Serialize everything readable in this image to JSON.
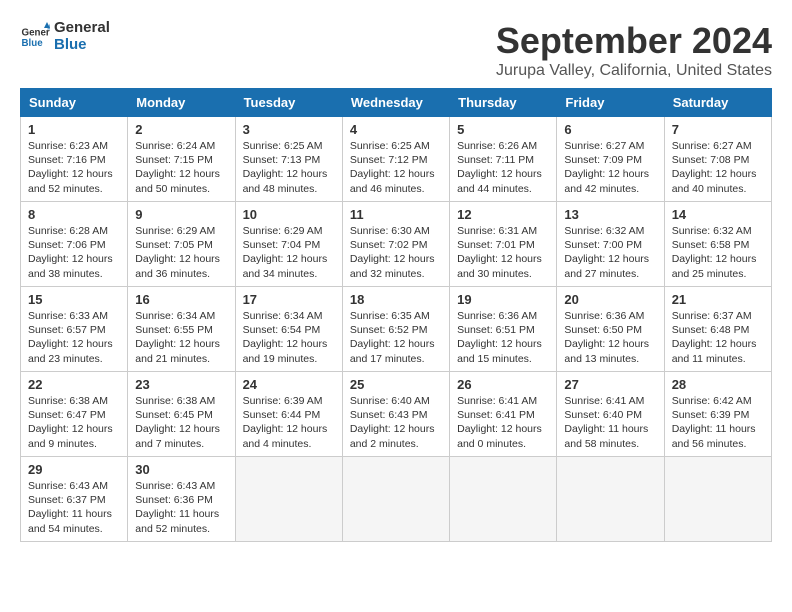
{
  "header": {
    "logo_line1": "General",
    "logo_line2": "Blue",
    "title": "September 2024",
    "subtitle": "Jurupa Valley, California, United States"
  },
  "columns": [
    "Sunday",
    "Monday",
    "Tuesday",
    "Wednesday",
    "Thursday",
    "Friday",
    "Saturday"
  ],
  "weeks": [
    [
      {
        "day": "1",
        "info": "Sunrise: 6:23 AM\nSunset: 7:16 PM\nDaylight: 12 hours\nand 52 minutes."
      },
      {
        "day": "2",
        "info": "Sunrise: 6:24 AM\nSunset: 7:15 PM\nDaylight: 12 hours\nand 50 minutes."
      },
      {
        "day": "3",
        "info": "Sunrise: 6:25 AM\nSunset: 7:13 PM\nDaylight: 12 hours\nand 48 minutes."
      },
      {
        "day": "4",
        "info": "Sunrise: 6:25 AM\nSunset: 7:12 PM\nDaylight: 12 hours\nand 46 minutes."
      },
      {
        "day": "5",
        "info": "Sunrise: 6:26 AM\nSunset: 7:11 PM\nDaylight: 12 hours\nand 44 minutes."
      },
      {
        "day": "6",
        "info": "Sunrise: 6:27 AM\nSunset: 7:09 PM\nDaylight: 12 hours\nand 42 minutes."
      },
      {
        "day": "7",
        "info": "Sunrise: 6:27 AM\nSunset: 7:08 PM\nDaylight: 12 hours\nand 40 minutes."
      }
    ],
    [
      {
        "day": "8",
        "info": "Sunrise: 6:28 AM\nSunset: 7:06 PM\nDaylight: 12 hours\nand 38 minutes."
      },
      {
        "day": "9",
        "info": "Sunrise: 6:29 AM\nSunset: 7:05 PM\nDaylight: 12 hours\nand 36 minutes."
      },
      {
        "day": "10",
        "info": "Sunrise: 6:29 AM\nSunset: 7:04 PM\nDaylight: 12 hours\nand 34 minutes."
      },
      {
        "day": "11",
        "info": "Sunrise: 6:30 AM\nSunset: 7:02 PM\nDaylight: 12 hours\nand 32 minutes."
      },
      {
        "day": "12",
        "info": "Sunrise: 6:31 AM\nSunset: 7:01 PM\nDaylight: 12 hours\nand 30 minutes."
      },
      {
        "day": "13",
        "info": "Sunrise: 6:32 AM\nSunset: 7:00 PM\nDaylight: 12 hours\nand 27 minutes."
      },
      {
        "day": "14",
        "info": "Sunrise: 6:32 AM\nSunset: 6:58 PM\nDaylight: 12 hours\nand 25 minutes."
      }
    ],
    [
      {
        "day": "15",
        "info": "Sunrise: 6:33 AM\nSunset: 6:57 PM\nDaylight: 12 hours\nand 23 minutes."
      },
      {
        "day": "16",
        "info": "Sunrise: 6:34 AM\nSunset: 6:55 PM\nDaylight: 12 hours\nand 21 minutes."
      },
      {
        "day": "17",
        "info": "Sunrise: 6:34 AM\nSunset: 6:54 PM\nDaylight: 12 hours\nand 19 minutes."
      },
      {
        "day": "18",
        "info": "Sunrise: 6:35 AM\nSunset: 6:52 PM\nDaylight: 12 hours\nand 17 minutes."
      },
      {
        "day": "19",
        "info": "Sunrise: 6:36 AM\nSunset: 6:51 PM\nDaylight: 12 hours\nand 15 minutes."
      },
      {
        "day": "20",
        "info": "Sunrise: 6:36 AM\nSunset: 6:50 PM\nDaylight: 12 hours\nand 13 minutes."
      },
      {
        "day": "21",
        "info": "Sunrise: 6:37 AM\nSunset: 6:48 PM\nDaylight: 12 hours\nand 11 minutes."
      }
    ],
    [
      {
        "day": "22",
        "info": "Sunrise: 6:38 AM\nSunset: 6:47 PM\nDaylight: 12 hours\nand 9 minutes."
      },
      {
        "day": "23",
        "info": "Sunrise: 6:38 AM\nSunset: 6:45 PM\nDaylight: 12 hours\nand 7 minutes."
      },
      {
        "day": "24",
        "info": "Sunrise: 6:39 AM\nSunset: 6:44 PM\nDaylight: 12 hours\nand 4 minutes."
      },
      {
        "day": "25",
        "info": "Sunrise: 6:40 AM\nSunset: 6:43 PM\nDaylight: 12 hours\nand 2 minutes."
      },
      {
        "day": "26",
        "info": "Sunrise: 6:41 AM\nSunset: 6:41 PM\nDaylight: 12 hours\nand 0 minutes."
      },
      {
        "day": "27",
        "info": "Sunrise: 6:41 AM\nSunset: 6:40 PM\nDaylight: 11 hours\nand 58 minutes."
      },
      {
        "day": "28",
        "info": "Sunrise: 6:42 AM\nSunset: 6:39 PM\nDaylight: 11 hours\nand 56 minutes."
      }
    ],
    [
      {
        "day": "29",
        "info": "Sunrise: 6:43 AM\nSunset: 6:37 PM\nDaylight: 11 hours\nand 54 minutes."
      },
      {
        "day": "30",
        "info": "Sunrise: 6:43 AM\nSunset: 6:36 PM\nDaylight: 11 hours\nand 52 minutes."
      },
      {
        "day": "",
        "info": ""
      },
      {
        "day": "",
        "info": ""
      },
      {
        "day": "",
        "info": ""
      },
      {
        "day": "",
        "info": ""
      },
      {
        "day": "",
        "info": ""
      }
    ]
  ]
}
